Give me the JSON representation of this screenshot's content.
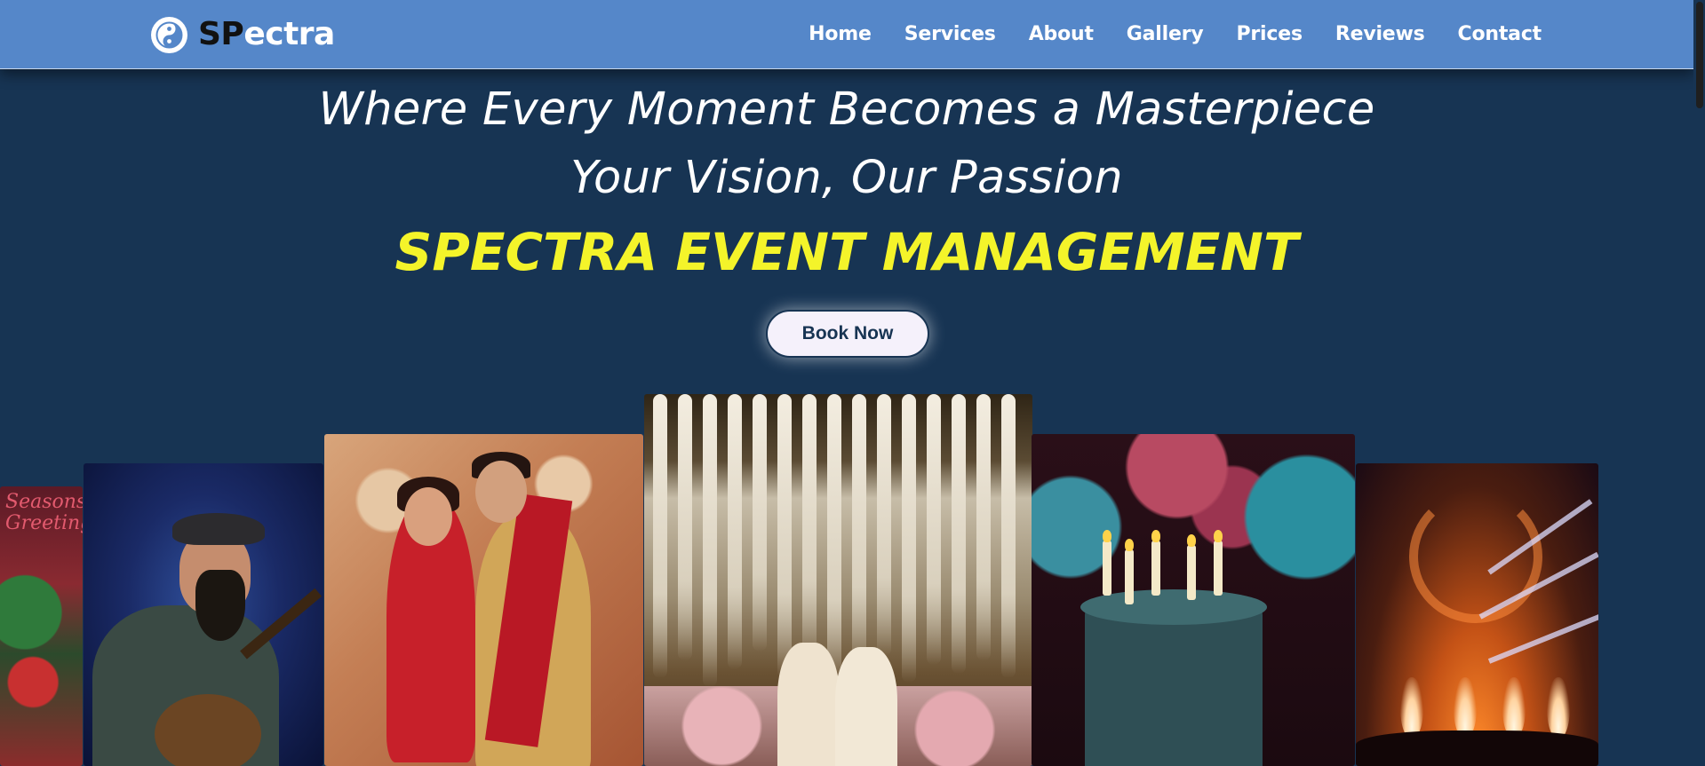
{
  "brand": {
    "name_dark": "SP",
    "name_light": "ectra",
    "logo_icon": "yin-yang-icon"
  },
  "nav": {
    "items": [
      "Home",
      "Services",
      "About",
      "Gallery",
      "Prices",
      "Reviews",
      "Contact"
    ]
  },
  "hero": {
    "line1": "Where Every Moment Becomes a Masterpiece",
    "line2": "Your Vision, Our Passion",
    "title": "SPECTRA EVENT MANAGEMENT",
    "cta_label": "Book Now"
  },
  "gallery": {
    "card1_text": "Seasons\nGreetings",
    "images": [
      "christmas-photo",
      "singer-guitar-photo",
      "indian-couple-photo",
      "wedding-stage-photo",
      "birthday-cake-photo",
      "concert-stage-photo"
    ]
  },
  "colors": {
    "navbar": "#5587c9",
    "background": "#173453",
    "title_yellow": "#f4f42a",
    "button_bg": "#f5f1fb"
  }
}
